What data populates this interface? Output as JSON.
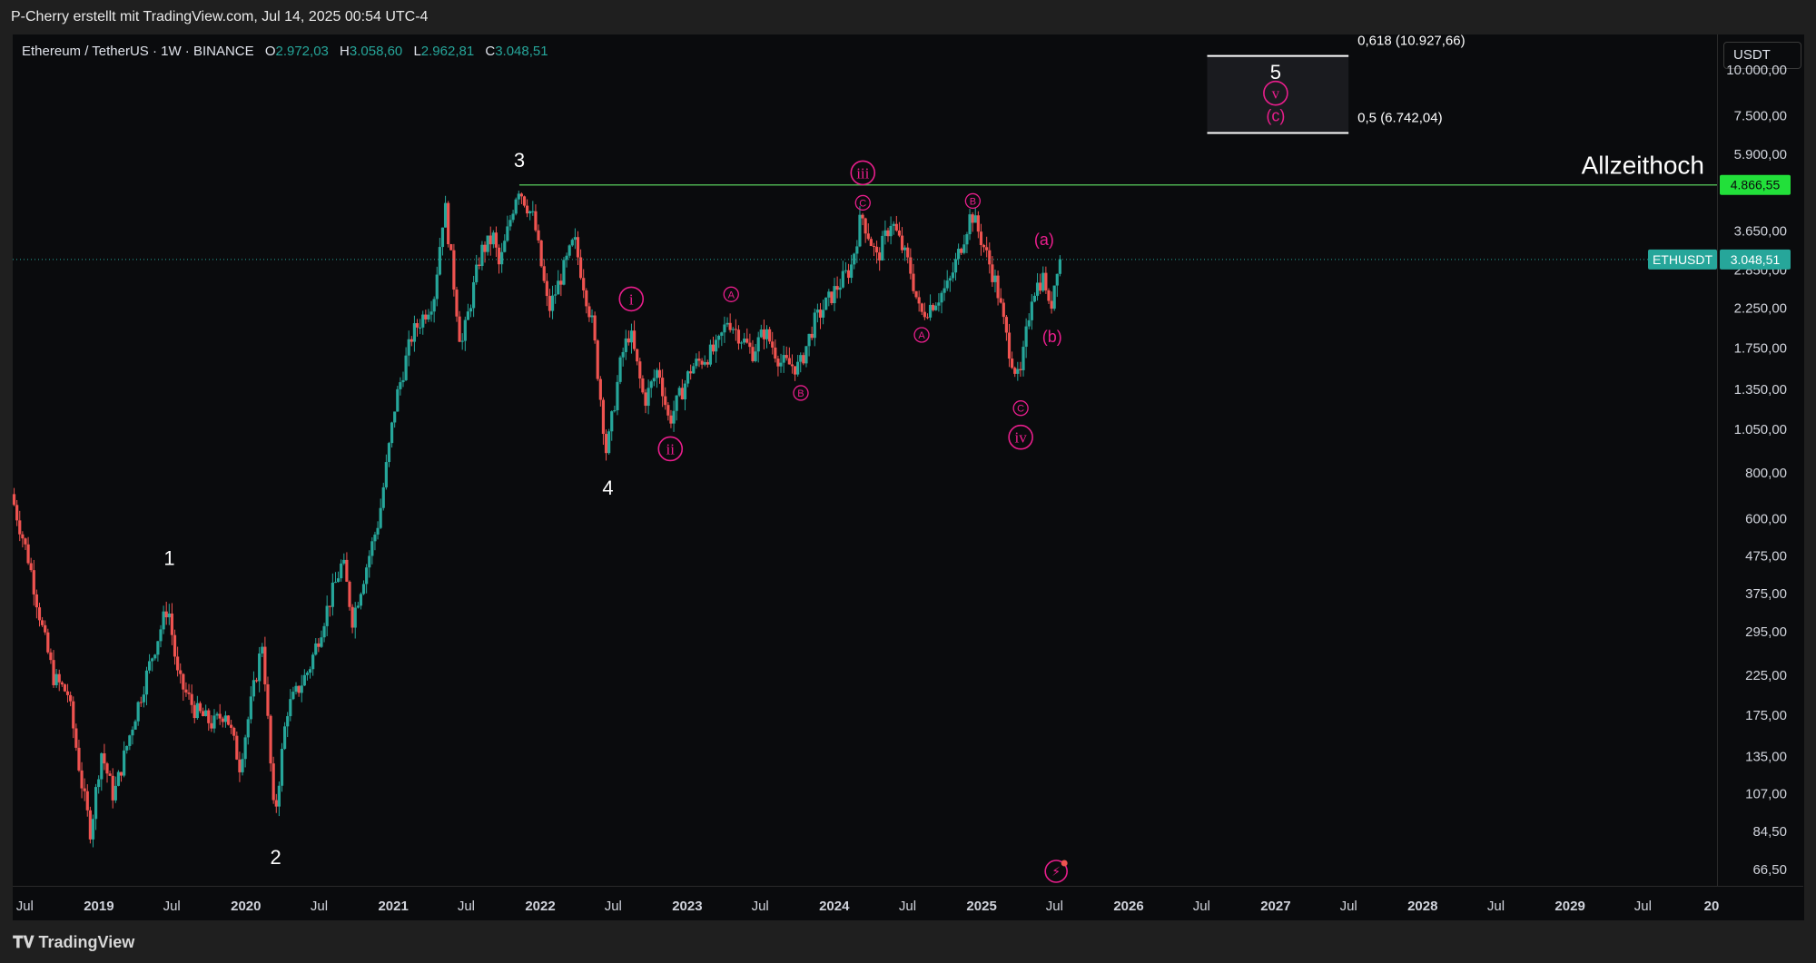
{
  "header": {
    "attribution": "P-Cherry erstellt mit TradingView.com, Jul 14, 2025 00:54 UTC-4"
  },
  "legend": {
    "symbol": "Ethereum / TetherUS · 1W · BINANCE",
    "open_label": "O",
    "open": "2.972,03",
    "high_label": "H",
    "high": "3.058,60",
    "low_label": "L",
    "low": "2.962,81",
    "close_label": "C",
    "close": "3.048,51"
  },
  "currency_button": "USDT",
  "footer": {
    "brand": "TradingView"
  },
  "colors": {
    "up": "#26a69a",
    "down": "#ef5350",
    "annotation": "#e91e8c",
    "ath_line": "#4caf50",
    "background": "#0a0b0d"
  },
  "chart_data": {
    "type": "candlestick",
    "scale": "log",
    "ylim": [
      60,
      12500
    ],
    "xlim": [
      "2018-06-01",
      "2030-01-01"
    ],
    "price_ticks": [
      "10.000,00",
      "7.500,00",
      "5.900,00",
      "3.650,00",
      "2.850,00",
      "2.250,00",
      "1.750,00",
      "1.350,00",
      "1.050,00",
      "800,00",
      "600,00",
      "475,00",
      "375,00",
      "295,00",
      "225,00",
      "175,00",
      "135,00",
      "107,00",
      "84,50",
      "66,50"
    ],
    "price_tick_values": [
      10000,
      7500,
      5900,
      3650,
      2850,
      2250,
      1750,
      1350,
      1050,
      800,
      600,
      475,
      375,
      295,
      225,
      175,
      135,
      107,
      84.5,
      66.5
    ],
    "time_ticks": [
      "Jul",
      "2019",
      "Jul",
      "2020",
      "Jul",
      "2021",
      "Jul",
      "2022",
      "Jul",
      "2023",
      "Jul",
      "2024",
      "Jul",
      "2025",
      "Jul",
      "2026",
      "Jul",
      "2027",
      "Jul",
      "2028",
      "Jul",
      "2029",
      "Jul",
      "20"
    ],
    "time_tick_dates": [
      "2018-07-01",
      "2019-01-01",
      "2019-07-01",
      "2020-01-01",
      "2020-07-01",
      "2021-01-01",
      "2021-07-01",
      "2022-01-01",
      "2022-07-01",
      "2023-01-01",
      "2023-07-01",
      "2024-01-01",
      "2024-07-01",
      "2025-01-01",
      "2025-07-01",
      "2026-01-01",
      "2026-07-01",
      "2027-01-01",
      "2027-07-01",
      "2028-01-01",
      "2028-07-01",
      "2029-01-01",
      "2029-07-01",
      "2030-01-01"
    ],
    "bold_time_ticks": [
      "2019",
      "2020",
      "2021",
      "2022",
      "2023",
      "2024",
      "2025",
      "2026",
      "2027",
      "2028",
      "2029",
      "20"
    ],
    "price_path": [
      [
        "2018-06-01",
        700
      ],
      [
        "2018-07-15",
        460
      ],
      [
        "2018-08-20",
        290
      ],
      [
        "2018-09-15",
        220
      ],
      [
        "2018-10-20",
        200
      ],
      [
        "2018-11-25",
        110
      ],
      [
        "2018-12-15",
        84
      ],
      [
        "2019-01-10",
        140
      ],
      [
        "2019-02-10",
        105
      ],
      [
        "2019-04-01",
        170
      ],
      [
        "2019-05-15",
        250
      ],
      [
        "2019-06-25",
        350
      ],
      [
        "2019-07-20",
        220
      ],
      [
        "2019-09-01",
        180
      ],
      [
        "2019-10-15",
        165
      ],
      [
        "2019-11-15",
        180
      ],
      [
        "2019-12-20",
        128
      ],
      [
        "2020-02-15",
        280
      ],
      [
        "2020-03-15",
        90
      ],
      [
        "2020-04-15",
        180
      ],
      [
        "2020-06-10",
        235
      ],
      [
        "2020-07-20",
        330
      ],
      [
        "2020-09-01",
        460
      ],
      [
        "2020-09-25",
        320
      ],
      [
        "2020-11-30",
        600
      ],
      [
        "2021-01-10",
        1250
      ],
      [
        "2021-02-20",
        1900
      ],
      [
        "2021-04-15",
        2400
      ],
      [
        "2021-05-12",
        4350
      ],
      [
        "2021-06-22",
        1750
      ],
      [
        "2021-08-10",
        3200
      ],
      [
        "2021-09-10",
        3500
      ],
      [
        "2021-09-25",
        2900
      ],
      [
        "2021-11-10",
        4850
      ],
      [
        "2021-12-20",
        3900
      ],
      [
        "2022-01-25",
        2200
      ],
      [
        "2022-03-30",
        3450
      ],
      [
        "2022-05-15",
        2000
      ],
      [
        "2022-06-18",
        900
      ],
      [
        "2022-07-25",
        1650
      ],
      [
        "2022-08-15",
        1950
      ],
      [
        "2022-09-20",
        1250
      ],
      [
        "2022-10-25",
        1550
      ],
      [
        "2022-11-20",
        1100
      ],
      [
        "2023-01-15",
        1550
      ],
      [
        "2023-03-20",
        1750
      ],
      [
        "2023-04-15",
        2100
      ],
      [
        "2023-06-15",
        1700
      ],
      [
        "2023-07-15",
        1950
      ],
      [
        "2023-08-25",
        1600
      ],
      [
        "2023-10-10",
        1550
      ],
      [
        "2023-11-15",
        2050
      ],
      [
        "2024-01-10",
        2550
      ],
      [
        "2024-02-15",
        2900
      ],
      [
        "2024-03-12",
        4050
      ],
      [
        "2024-04-20",
        3050
      ],
      [
        "2024-05-25",
        3900
      ],
      [
        "2024-07-10",
        2900
      ],
      [
        "2024-08-05",
        2150
      ],
      [
        "2024-09-10",
        2350
      ],
      [
        "2024-10-15",
        2600
      ],
      [
        "2024-12-10",
        4100
      ],
      [
        "2025-01-10",
        3300
      ],
      [
        "2025-02-10",
        2600
      ],
      [
        "2025-03-10",
        1800
      ],
      [
        "2025-04-08",
        1400
      ],
      [
        "2025-05-10",
        2500
      ],
      [
        "2025-06-10",
        2750
      ],
      [
        "2025-06-22",
        2150
      ],
      [
        "2025-07-13",
        3048
      ]
    ],
    "all_time_high_line": {
      "value": 4866.55,
      "label": "Allzeithoch",
      "price_badge": "4.866,55",
      "from": "2021-11-10"
    },
    "current_price": {
      "value": 3048.51,
      "badge_symbol": "ETHUSDT",
      "badge_price": "3.048,51"
    },
    "fib_targets": [
      {
        "label": "0,618 (10.927,66)",
        "value": 10927.66
      },
      {
        "label": "0,5 (6.742,04)",
        "value": 6742.04
      }
    ],
    "target_box": {
      "from": "2026-07-15",
      "to": "2027-07-01",
      "low": 6742.04,
      "high": 10927.66
    },
    "wave_labels": [
      {
        "text": "1",
        "date": "2019-06-25",
        "price": 470,
        "style": "white"
      },
      {
        "text": "2",
        "date": "2020-03-15",
        "price": 72,
        "style": "white"
      },
      {
        "text": "3",
        "date": "2021-11-10",
        "price": 5700,
        "style": "white"
      },
      {
        "text": "4",
        "date": "2022-06-18",
        "price": 730,
        "style": "white"
      },
      {
        "text": "5",
        "date": "2027-01-01",
        "price": 9900,
        "style": "white"
      },
      {
        "text": "i",
        "date": "2022-08-15",
        "price": 2380,
        "style": "circle"
      },
      {
        "text": "ii",
        "date": "2022-11-20",
        "price": 930,
        "style": "circle"
      },
      {
        "text": "iii",
        "date": "2024-03-12",
        "price": 5250,
        "style": "circle"
      },
      {
        "text": "iv",
        "date": "2025-04-08",
        "price": 1000,
        "style": "circle"
      },
      {
        "text": "v",
        "date": "2027-01-01",
        "price": 8650,
        "style": "circle"
      },
      {
        "text": "A",
        "date": "2023-04-20",
        "price": 2450,
        "style": "small-circle"
      },
      {
        "text": "B",
        "date": "2023-10-10",
        "price": 1320,
        "style": "small-circle"
      },
      {
        "text": "C",
        "date": "2024-03-12",
        "price": 4350,
        "style": "small-circle"
      },
      {
        "text": "A",
        "date": "2024-08-05",
        "price": 1900,
        "style": "small-circle"
      },
      {
        "text": "B",
        "date": "2024-12-10",
        "price": 4400,
        "style": "small-circle"
      },
      {
        "text": "C",
        "date": "2025-04-08",
        "price": 1200,
        "style": "small-circle"
      },
      {
        "text": "(a)",
        "date": "2025-06-05",
        "price": 3450,
        "style": "text"
      },
      {
        "text": "(b)",
        "date": "2025-06-25",
        "price": 1880,
        "style": "text"
      },
      {
        "text": "(c)",
        "date": "2027-01-01",
        "price": 7520,
        "style": "text"
      }
    ]
  }
}
